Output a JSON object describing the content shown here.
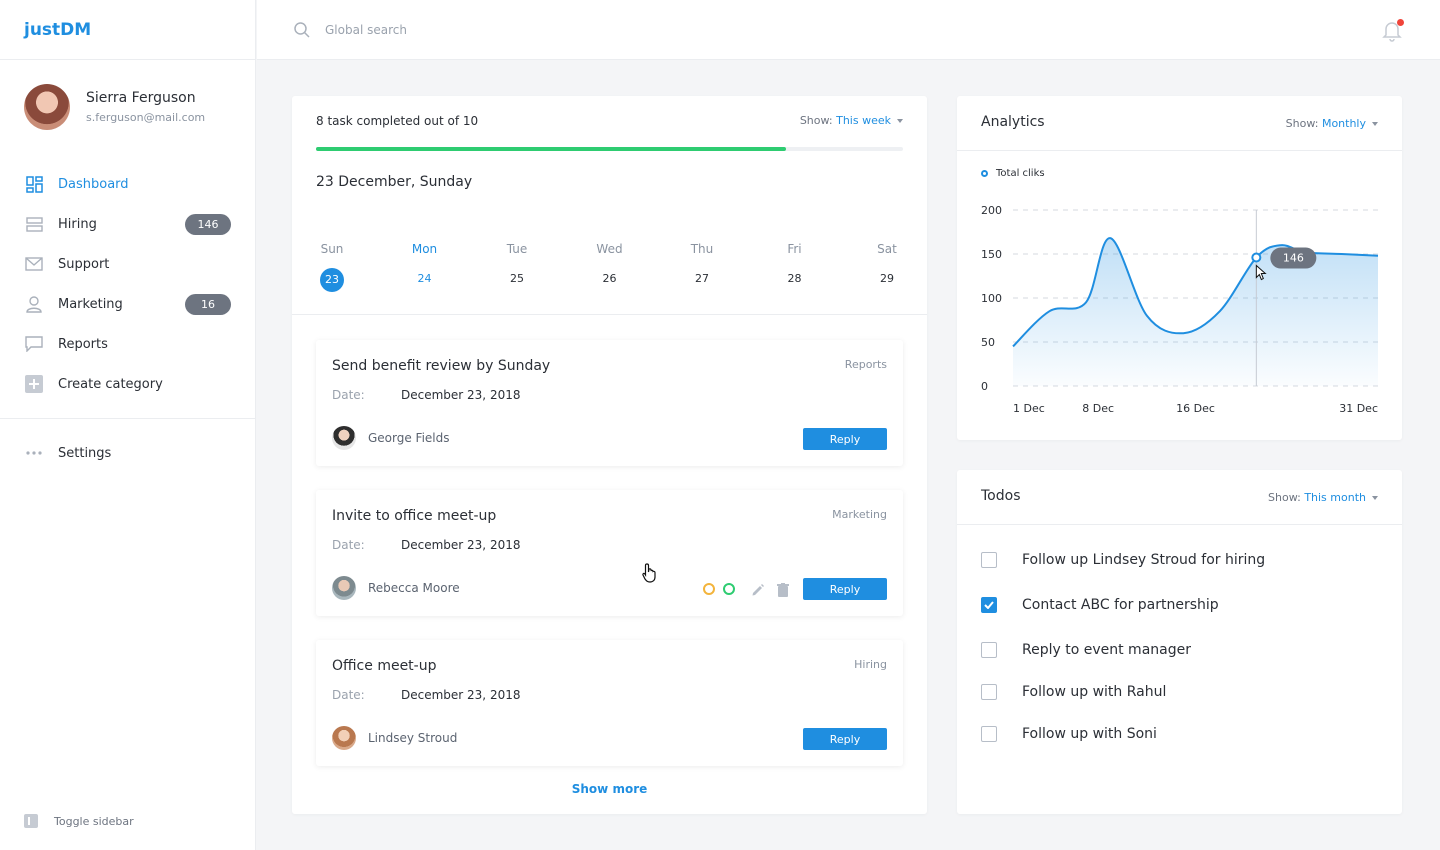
{
  "app": {
    "title": "justDM"
  },
  "user": {
    "name": "Sierra Ferguson",
    "email": "s.ferguson@mail.com"
  },
  "sidebar": {
    "items": [
      {
        "label": "Dashboard",
        "icon": "grid-icon",
        "active": true
      },
      {
        "label": "Hiring",
        "icon": "layers-icon",
        "badge": "146"
      },
      {
        "label": "Support",
        "icon": "mail-icon"
      },
      {
        "label": "Marketing",
        "icon": "user-icon",
        "badge": "16"
      },
      {
        "label": "Reports",
        "icon": "chat-icon"
      },
      {
        "label": "Create category",
        "icon": "plus-box-icon"
      }
    ],
    "settings": "Settings",
    "toggle": "Toggle sidebar"
  },
  "search": {
    "placeholder": "Global search"
  },
  "tasks": {
    "summary": "8 task completed out of 10",
    "show_label": "Show:",
    "show_value": "This week",
    "progress": 0.8,
    "date_title": "23 December, Sunday",
    "week": [
      {
        "name": "Sun",
        "num": "23"
      },
      {
        "name": "Mon",
        "num": "24"
      },
      {
        "name": "Tue",
        "num": "25"
      },
      {
        "name": "Wed",
        "num": "26"
      },
      {
        "name": "Thu",
        "num": "27"
      },
      {
        "name": "Fri",
        "num": "28"
      },
      {
        "name": "Sat",
        "num": "29"
      }
    ],
    "items": [
      {
        "title": "Send benefit review by Sunday",
        "category": "Reports",
        "date_label": "Date:",
        "date": "December 23, 2018",
        "person": "George Fields",
        "reply": "Reply"
      },
      {
        "title": "Invite to office meet-up",
        "category": "Marketing",
        "date_label": "Date:",
        "date": "December 23, 2018",
        "person": "Rebecca Moore",
        "reply": "Reply"
      },
      {
        "title": "Office meet-up",
        "category": "Hiring",
        "date_label": "Date:",
        "date": "December 23, 2018",
        "person": "Lindsey Stroud",
        "reply": "Reply"
      }
    ],
    "show_more": "Show more"
  },
  "analytics": {
    "title": "Analytics",
    "show_label": "Show:",
    "show_value": "Monthly",
    "legend": "Total cliks",
    "tooltip": "146"
  },
  "chart_data": {
    "type": "area",
    "series": [
      {
        "name": "Total cliks",
        "x": [
          1,
          4,
          7,
          9,
          12,
          15,
          18,
          21,
          23,
          25,
          28,
          31
        ],
        "y": [
          45,
          85,
          95,
          168,
          80,
          60,
          85,
          146,
          160,
          152,
          150,
          148
        ]
      }
    ],
    "x_ticks": [
      "1 Dec",
      "8 Dec",
      "16 Dec",
      "31 Dec"
    ],
    "y_ticks": [
      0,
      50,
      100,
      150,
      200
    ],
    "ylim": [
      0,
      200
    ],
    "grid": true,
    "highlight": {
      "x": 21,
      "y": 146
    },
    "color": "#1f8ee0"
  },
  "todos": {
    "title": "Todos",
    "show_label": "Show:",
    "show_value": "This month",
    "items": [
      {
        "text": "Follow up Lindsey Stroud for hiring",
        "checked": false
      },
      {
        "text": "Contact ABC for partnership",
        "checked": true
      },
      {
        "text": "Reply to event manager",
        "checked": false
      },
      {
        "text": "Follow up with Rahul",
        "checked": false
      },
      {
        "text": "Follow up with Soni",
        "checked": false
      }
    ]
  },
  "colors": {
    "accent": "#1f8ee0",
    "success": "#2ecc71",
    "badge": "#6d7480"
  }
}
